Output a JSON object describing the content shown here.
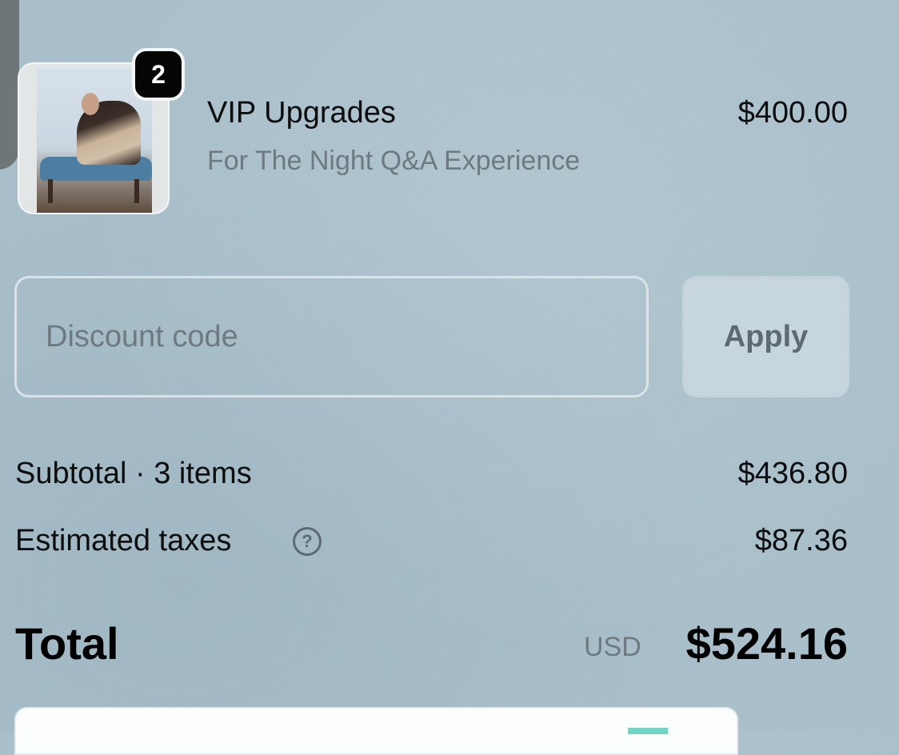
{
  "top_cutoff_text": "",
  "product": {
    "quantity": "2",
    "name": "VIP Upgrades",
    "variant": "For The Night Q&A Experience",
    "price": "$400.00",
    "image_alt": "Product image"
  },
  "discount": {
    "placeholder": "Discount code",
    "value": "",
    "apply_label": "Apply"
  },
  "summary": {
    "subtotal_label": "Subtotal · 3 items",
    "subtotal_value": "$436.80",
    "taxes_label": "Estimated taxes",
    "taxes_help_icon": "?",
    "taxes_value": "$87.36"
  },
  "total": {
    "label": "Total",
    "currency": "USD",
    "amount": "$524.16"
  },
  "colors": {
    "background": "#a9c0cb",
    "badge": "#050505",
    "muted_text": "#6e7a80",
    "apply_button_bg": "#c7d6de"
  }
}
